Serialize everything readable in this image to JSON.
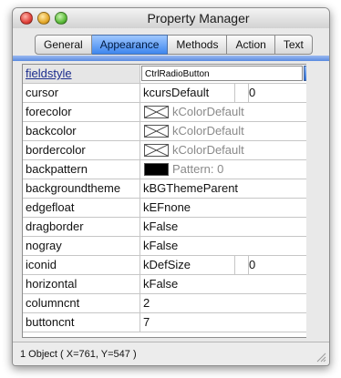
{
  "window": {
    "title": "Property Manager"
  },
  "tabs": [
    {
      "label": "General"
    },
    {
      "label": "Appearance"
    },
    {
      "label": "Methods"
    },
    {
      "label": "Action"
    },
    {
      "label": "Text"
    }
  ],
  "active_tab": "Appearance",
  "rows": [
    {
      "name": "fieldstyle",
      "value": "CtrlRadioButton"
    },
    {
      "name": "cursor",
      "value": "kcursDefault",
      "extra": "0"
    },
    {
      "name": "forecolor",
      "value": "kColorDefault"
    },
    {
      "name": "backcolor",
      "value": "kColorDefault"
    },
    {
      "name": "bordercolor",
      "value": "kColorDefault"
    },
    {
      "name": "backpattern",
      "value": "Pattern: 0"
    },
    {
      "name": "backgroundtheme",
      "value": "kBGThemeParent"
    },
    {
      "name": "edgefloat",
      "value": "kEFnone"
    },
    {
      "name": "dragborder",
      "value": "kFalse"
    },
    {
      "name": "nogray",
      "value": "kFalse"
    },
    {
      "name": "iconid",
      "value": "kDefSize",
      "extra": "0"
    },
    {
      "name": "horizontal",
      "value": "kFalse"
    },
    {
      "name": "columncnt",
      "value": "2"
    },
    {
      "name": "buttoncnt",
      "value": "7"
    }
  ],
  "status": {
    "text": "1 Object ( X=761, Y=547 )"
  },
  "colors": {
    "accent": "#3e86ee",
    "selected_label": "#1c2d8e"
  }
}
